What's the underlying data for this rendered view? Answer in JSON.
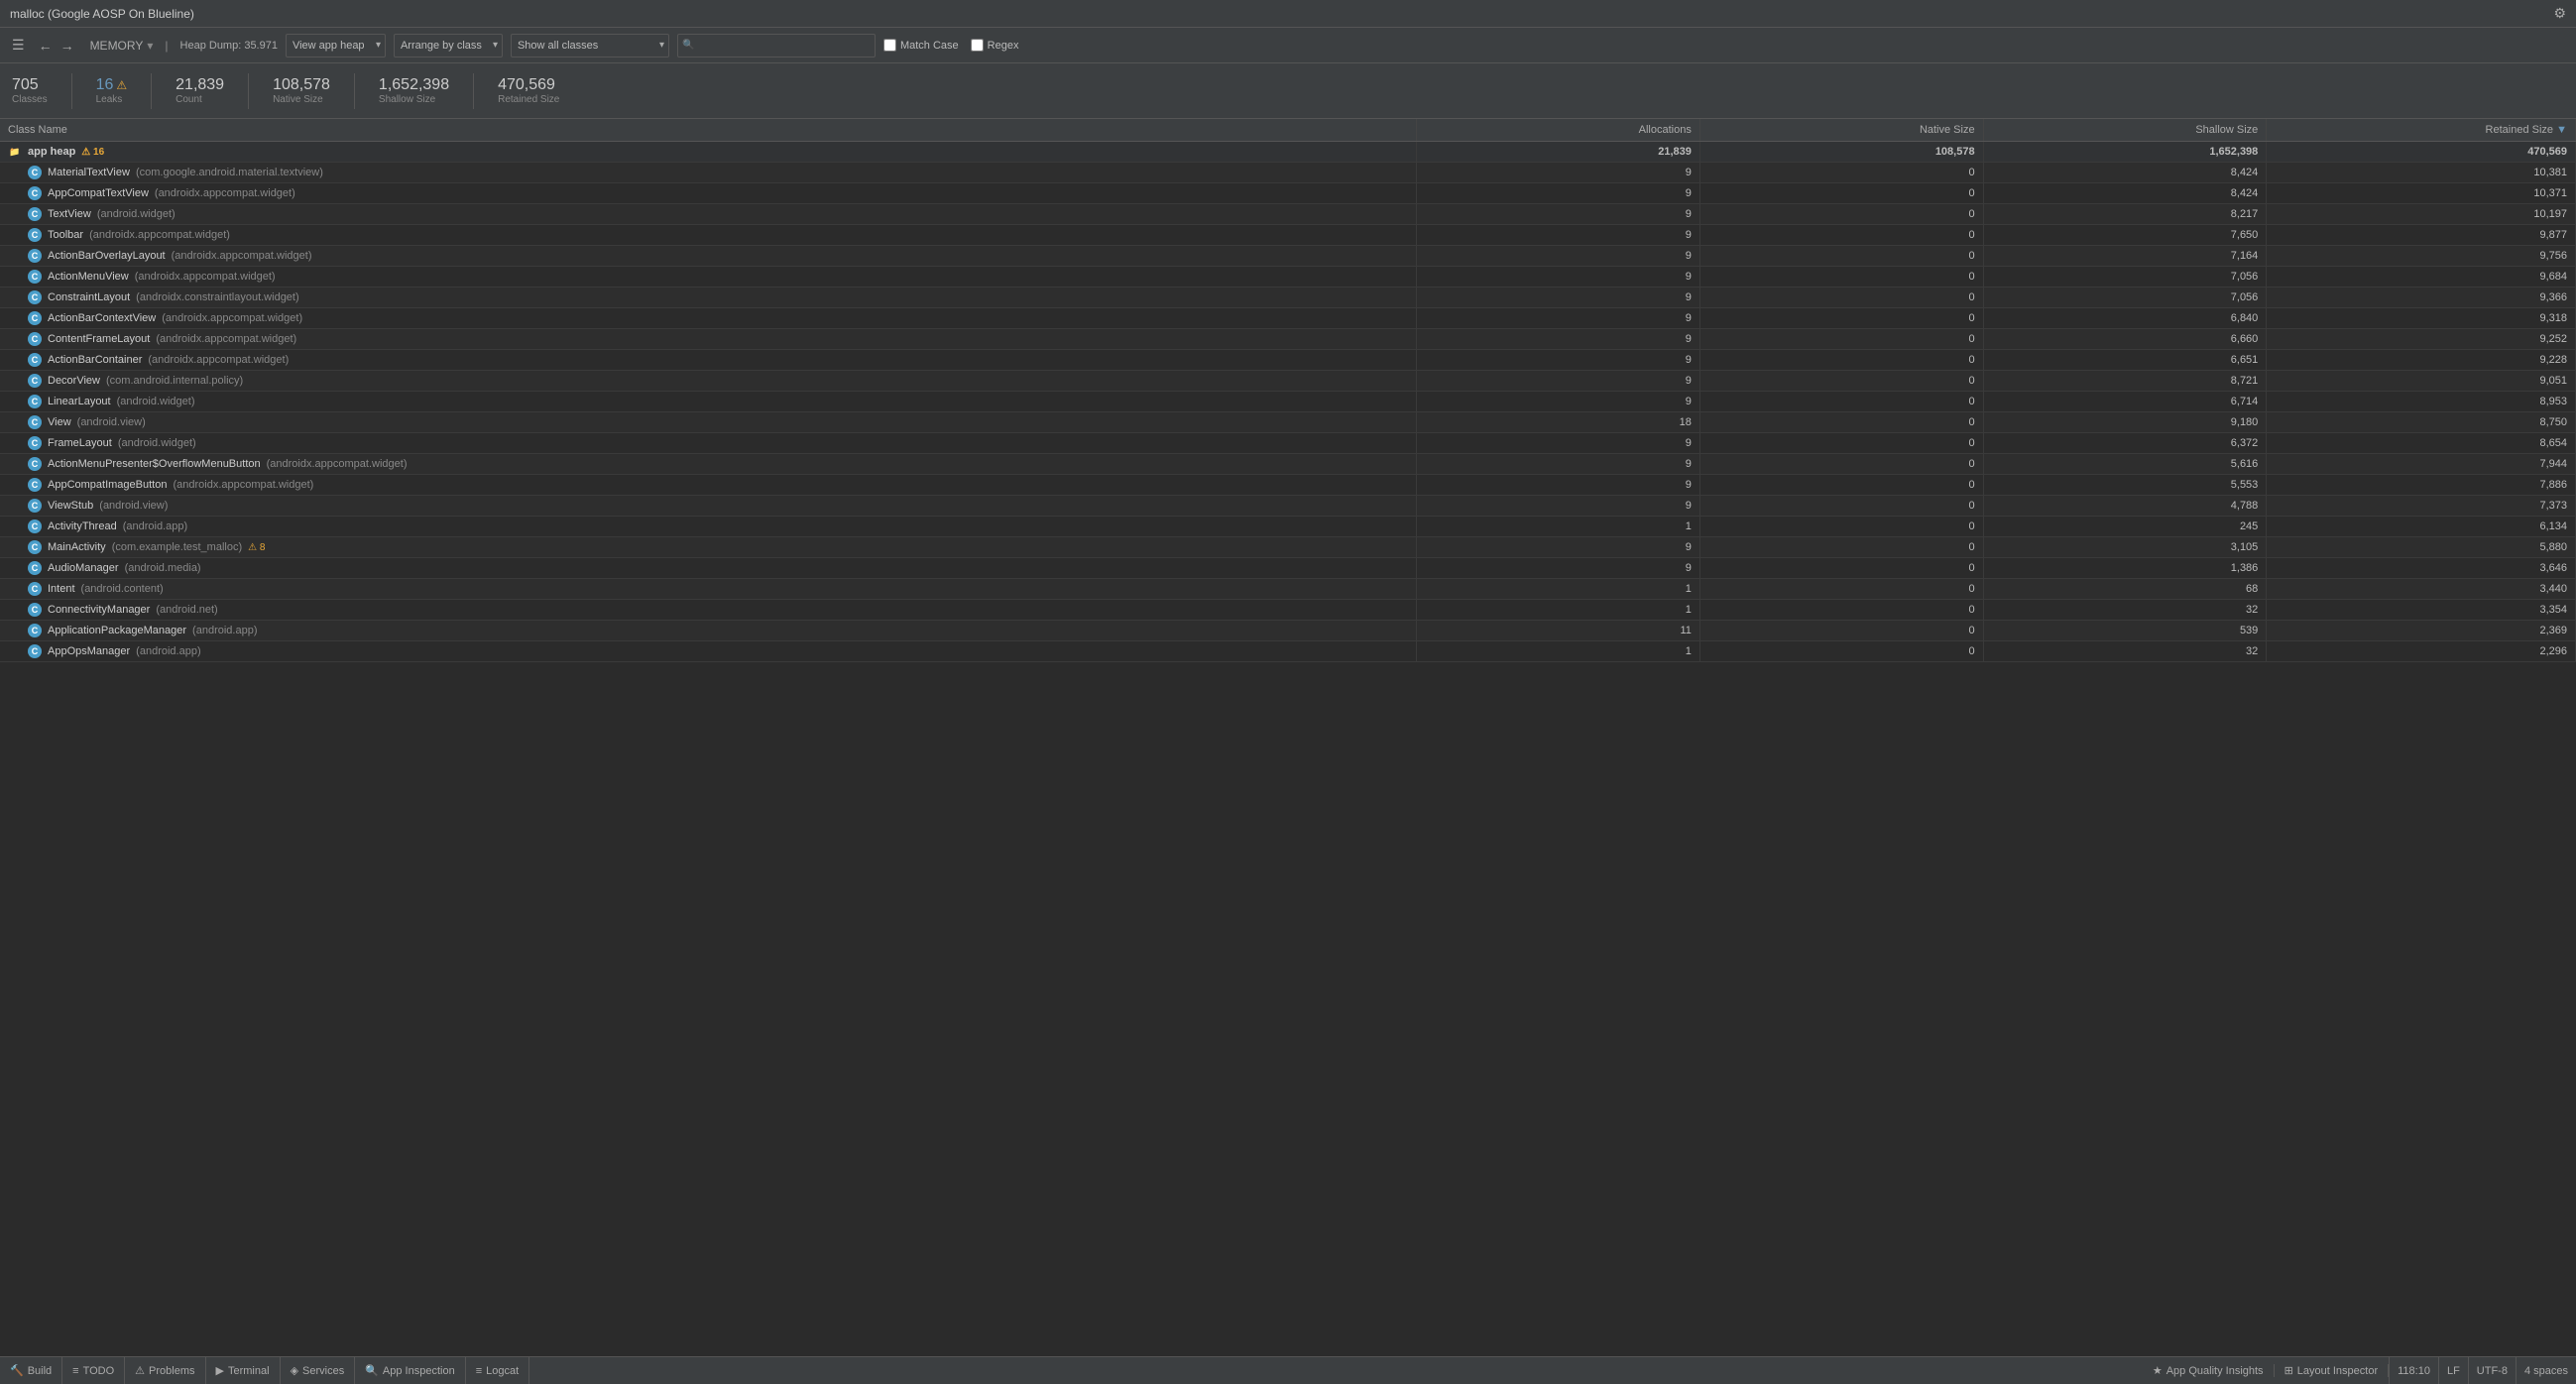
{
  "titleBar": {
    "title": "malloc (Google AOSP On Blueline)",
    "gearIcon": "⚙"
  },
  "toolbar": {
    "sidebarToggleIcon": "☰",
    "backIcon": "←",
    "forwardIcon": "→",
    "memoryLabel": "MEMORY",
    "heapDump": "Heap Dump: 35.971",
    "viewAppHeap": "View app heap",
    "arrangeByClass": "Arrange by class",
    "showAllClasses": "Show all classes",
    "searchPlaceholder": "🔍",
    "matchCase": "Match Case",
    "regex": "Regex"
  },
  "stats": {
    "classes": {
      "value": "705",
      "label": "Classes"
    },
    "leaks": {
      "value": "16",
      "label": "Leaks",
      "icon": "⚠"
    },
    "count": {
      "value": "21,839",
      "label": "Count"
    },
    "nativeSize": {
      "value": "108,578",
      "label": "Native Size"
    },
    "shallowSize": {
      "value": "1,652,398",
      "label": "Shallow Size"
    },
    "retainedSize": {
      "value": "470,569",
      "label": "Retained Size"
    }
  },
  "table": {
    "columns": [
      "Class Name",
      "Allocations",
      "Native Size",
      "Shallow Size",
      "Retained Size"
    ],
    "rows": [
      {
        "type": "heap",
        "name": "app heap",
        "warning": "⚠ 16",
        "allocations": "21,839",
        "nativeSize": "108,578",
        "shallowSize": "1,652,398",
        "retainedSize": "470,569"
      },
      {
        "type": "class",
        "simpleName": "MaterialTextView",
        "packageName": "(com.google.android.material.textview)",
        "allocations": "9",
        "nativeSize": "0",
        "shallowSize": "8,424",
        "retainedSize": "10,381"
      },
      {
        "type": "class",
        "simpleName": "AppCompatTextView",
        "packageName": "(androidx.appcompat.widget)",
        "allocations": "9",
        "nativeSize": "0",
        "shallowSize": "8,424",
        "retainedSize": "10,371"
      },
      {
        "type": "class",
        "simpleName": "TextView",
        "packageName": "(android.widget)",
        "allocations": "9",
        "nativeSize": "0",
        "shallowSize": "8,217",
        "retainedSize": "10,197"
      },
      {
        "type": "class",
        "simpleName": "Toolbar",
        "packageName": "(androidx.appcompat.widget)",
        "allocations": "9",
        "nativeSize": "0",
        "shallowSize": "7,650",
        "retainedSize": "9,877"
      },
      {
        "type": "class",
        "simpleName": "ActionBarOverlayLayout",
        "packageName": "(androidx.appcompat.widget)",
        "allocations": "9",
        "nativeSize": "0",
        "shallowSize": "7,164",
        "retainedSize": "9,756"
      },
      {
        "type": "class",
        "simpleName": "ActionMenuView",
        "packageName": "(androidx.appcompat.widget)",
        "allocations": "9",
        "nativeSize": "0",
        "shallowSize": "7,056",
        "retainedSize": "9,684"
      },
      {
        "type": "class",
        "simpleName": "ConstraintLayout",
        "packageName": "(androidx.constraintlayout.widget)",
        "allocations": "9",
        "nativeSize": "0",
        "shallowSize": "7,056",
        "retainedSize": "9,366"
      },
      {
        "type": "class",
        "simpleName": "ActionBarContextView",
        "packageName": "(androidx.appcompat.widget)",
        "allocations": "9",
        "nativeSize": "0",
        "shallowSize": "6,840",
        "retainedSize": "9,318"
      },
      {
        "type": "class",
        "simpleName": "ContentFrameLayout",
        "packageName": "(androidx.appcompat.widget)",
        "allocations": "9",
        "nativeSize": "0",
        "shallowSize": "6,660",
        "retainedSize": "9,252"
      },
      {
        "type": "class",
        "simpleName": "ActionBarContainer",
        "packageName": "(androidx.appcompat.widget)",
        "allocations": "9",
        "nativeSize": "0",
        "shallowSize": "6,651",
        "retainedSize": "9,228"
      },
      {
        "type": "class",
        "simpleName": "DecorView",
        "packageName": "(com.android.internal.policy)",
        "allocations": "9",
        "nativeSize": "0",
        "shallowSize": "8,721",
        "retainedSize": "9,051"
      },
      {
        "type": "class",
        "simpleName": "LinearLayout",
        "packageName": "(android.widget)",
        "allocations": "9",
        "nativeSize": "0",
        "shallowSize": "6,714",
        "retainedSize": "8,953"
      },
      {
        "type": "class",
        "simpleName": "View",
        "packageName": "(android.view)",
        "allocations": "18",
        "nativeSize": "0",
        "shallowSize": "9,180",
        "retainedSize": "8,750"
      },
      {
        "type": "class",
        "simpleName": "FrameLayout",
        "packageName": "(android.widget)",
        "allocations": "9",
        "nativeSize": "0",
        "shallowSize": "6,372",
        "retainedSize": "8,654"
      },
      {
        "type": "class",
        "simpleName": "ActionMenuPresenter$OverflowMenuButton",
        "packageName": "(androidx.appcompat.widget)",
        "allocations": "9",
        "nativeSize": "0",
        "shallowSize": "5,616",
        "retainedSize": "7,944"
      },
      {
        "type": "class",
        "simpleName": "AppCompatImageButton",
        "packageName": "(androidx.appcompat.widget)",
        "allocations": "9",
        "nativeSize": "0",
        "shallowSize": "5,553",
        "retainedSize": "7,886"
      },
      {
        "type": "class",
        "simpleName": "ViewStub",
        "packageName": "(android.view)",
        "allocations": "9",
        "nativeSize": "0",
        "shallowSize": "4,788",
        "retainedSize": "7,373"
      },
      {
        "type": "class",
        "simpleName": "ActivityThread",
        "packageName": "(android.app)",
        "allocations": "1",
        "nativeSize": "0",
        "shallowSize": "245",
        "retainedSize": "6,134"
      },
      {
        "type": "class",
        "simpleName": "MainActivity",
        "packageName": "(com.example.test_malloc)",
        "warning": "⚠ 8",
        "allocations": "9",
        "nativeSize": "0",
        "shallowSize": "3,105",
        "retainedSize": "5,880"
      },
      {
        "type": "class",
        "simpleName": "AudioManager",
        "packageName": "(android.media)",
        "allocations": "9",
        "nativeSize": "0",
        "shallowSize": "1,386",
        "retainedSize": "3,646"
      },
      {
        "type": "class",
        "simpleName": "Intent",
        "packageName": "(android.content)",
        "allocations": "1",
        "nativeSize": "0",
        "shallowSize": "68",
        "retainedSize": "3,440"
      },
      {
        "type": "class",
        "simpleName": "ConnectivityManager",
        "packageName": "(android.net)",
        "allocations": "1",
        "nativeSize": "0",
        "shallowSize": "32",
        "retainedSize": "3,354"
      },
      {
        "type": "class",
        "simpleName": "ApplicationPackageManager",
        "packageName": "(android.app)",
        "allocations": "11",
        "nativeSize": "0",
        "shallowSize": "539",
        "retainedSize": "2,369"
      },
      {
        "type": "class",
        "simpleName": "AppOpsManager",
        "packageName": "(android.app)",
        "allocations": "1",
        "nativeSize": "0",
        "shallowSize": "32",
        "retainedSize": "2,296"
      }
    ]
  },
  "statusBar": {
    "tabs": [
      {
        "icon": "🔨",
        "label": "Build"
      },
      {
        "icon": "≡",
        "label": "TODO"
      },
      {
        "icon": "⚠",
        "label": "Problems"
      },
      {
        "icon": "▶",
        "label": "Terminal"
      },
      {
        "icon": "◈",
        "label": "Services"
      },
      {
        "icon": "🔍",
        "label": "App Inspection"
      },
      {
        "icon": "≡",
        "label": "Logcat"
      }
    ],
    "rightTabs": [
      {
        "icon": "⊞",
        "label": "Layout Inspector"
      },
      {
        "icon": "★",
        "label": "App Quality Insights"
      }
    ],
    "position": "118:10",
    "encoding": "LF",
    "charset": "UTF-8",
    "indent": "4 spaces"
  }
}
